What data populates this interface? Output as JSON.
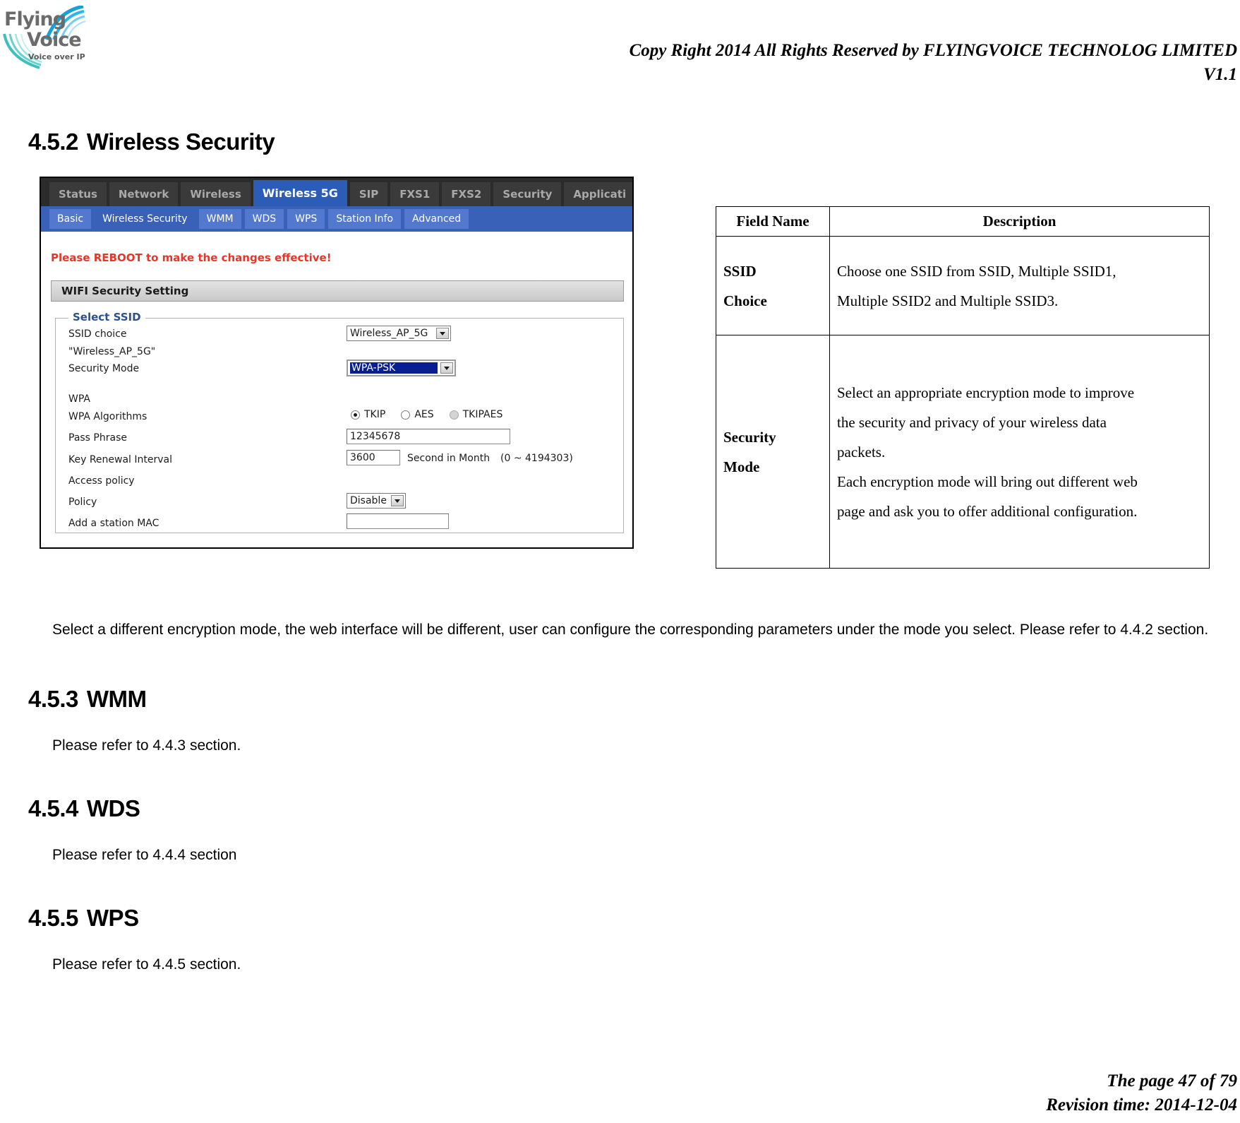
{
  "header": {
    "logo": {
      "line1": "Flying",
      "line2": "Voice",
      "tagline": "Voice over IP"
    },
    "copyright": "Copy Right 2014 All Rights Reserved by FLYINGVOICE TECHNOLOG LIMITED",
    "version": "V1.1"
  },
  "sections": {
    "s452": {
      "number": "4.5.2",
      "title": "Wireless Security"
    },
    "s453": {
      "number": "4.5.3",
      "title": "WMM",
      "body": "Please refer to 4.4.3 section."
    },
    "s454": {
      "number": "4.5.4",
      "title": "WDS",
      "body": "Please refer to 4.4.4 section"
    },
    "s455": {
      "number": "4.5.5",
      "title": "WPS",
      "body": "Please refer to 4.4.5 section."
    }
  },
  "note_paragraph": "Select a different encryption mode, the web interface will be different, user can configure the corresponding parameters under the mode you select. Please refer to 4.4.2 section.",
  "ui": {
    "tabs": [
      {
        "label": "Status",
        "active": false
      },
      {
        "label": "Network",
        "active": false
      },
      {
        "label": "Wireless",
        "active": false
      },
      {
        "label": "Wireless 5G",
        "active": true
      },
      {
        "label": "SIP",
        "active": false
      },
      {
        "label": "FXS1",
        "active": false
      },
      {
        "label": "FXS2",
        "active": false
      },
      {
        "label": "Security",
        "active": false
      },
      {
        "label": "Applicati",
        "active": false
      }
    ],
    "subtabs": [
      {
        "label": "Basic",
        "active": false
      },
      {
        "label": "Wireless Security",
        "active": true
      },
      {
        "label": "WMM",
        "active": false
      },
      {
        "label": "WDS",
        "active": false
      },
      {
        "label": "WPS",
        "active": false
      },
      {
        "label": "Station Info",
        "active": false
      },
      {
        "label": "Advanced",
        "active": false
      }
    ],
    "reboot_message": "Please REBOOT to make the changes effective!",
    "panel_title": "WIFI Security Setting",
    "fieldset_legend": "Select SSID",
    "fields": {
      "ssid_choice_label": "SSID choice",
      "ssid_choice_value": "Wireless_AP_5G",
      "ssid_name_label": "\"Wireless_AP_5G\"",
      "security_mode_label": "Security Mode",
      "security_mode_value": "WPA-PSK",
      "wpa_group_label": "WPA",
      "wpa_algorithms_label": "WPA Algorithms",
      "wpa_algorithms": [
        {
          "label": "TKIP",
          "state": "checked"
        },
        {
          "label": "AES",
          "state": "unchecked"
        },
        {
          "label": "TKIPAES",
          "state": "disabled"
        }
      ],
      "pass_phrase_label": "Pass Phrase",
      "pass_phrase_value": "12345678",
      "key_renewal_label": "Key Renewal Interval",
      "key_renewal_value": "3600",
      "key_renewal_unit": "Second in Month",
      "key_renewal_range": "(0 ~ 4194303)",
      "access_policy_label": "Access policy",
      "policy_label": "Policy",
      "policy_value": "Disable",
      "add_station_mac_label": "Add a station MAC",
      "add_station_mac_value": ""
    },
    "colors": {
      "tabbar_bg": "#2b2b2b",
      "active_tab": "#2b5cb8",
      "subtab_bg": "#3a61b8",
      "alert_red": "#e8352a",
      "legend_blue": "#2c4f8e"
    }
  },
  "table": {
    "headers": [
      "Field Name",
      "Description"
    ],
    "rows": [
      {
        "field": [
          "SSID",
          "Choice"
        ],
        "description": [
          "Choose one SSID from SSID, Multiple SSID1,",
          "Multiple SSID2 and Multiple SSID3."
        ]
      },
      {
        "field": [
          "Security",
          "Mode"
        ],
        "description": [
          "Select an appropriate encryption mode to improve",
          "the security and privacy of your wireless data",
          "packets.",
          "Each encryption mode will bring out different web",
          "page and ask you to offer additional configuration."
        ]
      }
    ]
  },
  "footer": {
    "page": "The page 47 of 79",
    "revision": "Revision time: 2014-12-04"
  }
}
